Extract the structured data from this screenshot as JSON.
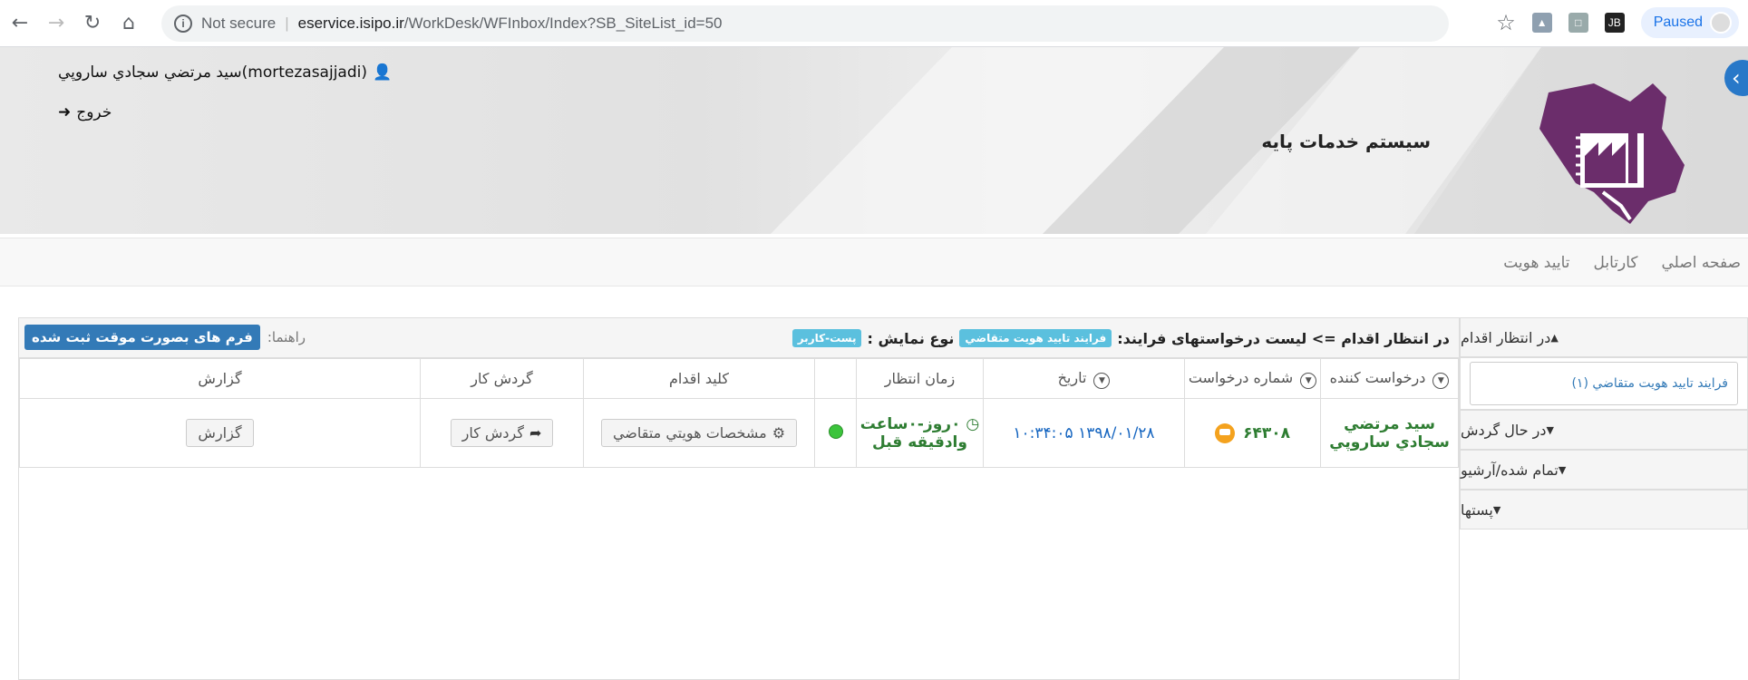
{
  "browser": {
    "secure_label": "Not secure",
    "url_host": "eservice.isipo.ir",
    "url_path": "/WorkDesk/WFInbox/Index?SB_SiteList_id=50",
    "paused_label": "Paused",
    "ext_jb": "JB"
  },
  "header": {
    "user_name": "سيد مرتضي سجادي ساروپي(mortezasajjadi)",
    "logout_label": "خروج",
    "site_title": "سيستم خدمات پايه"
  },
  "nav": {
    "items": [
      "صفحه اصلي",
      "کارتابل",
      "تایید هویت"
    ]
  },
  "sidebar": {
    "pending": "در انتظار اقدام",
    "pending_sub": "فرايند تاييد هويت متقاضي (۱)",
    "in_progress": "در حال گردش",
    "archive": "تمام شده/آرشيو",
    "posts": "پستها"
  },
  "panel": {
    "title_prefix": "در انتظار اقدام => لیست درخواستهای فرایند:",
    "process_label": "فرايند تاييد هويت متقاضي",
    "view_type_text": "نوع نمایش :",
    "view_type_label": "پست-کاربر",
    "guide_label": "راهنما:",
    "guide_button": "فرم های بصورت موقت ثبت شده"
  },
  "table": {
    "headers": [
      "درخواست کننده",
      "شماره درخواست",
      "تاریخ",
      "زمان انتظار",
      "",
      "کلید اقدام",
      "گردش کار",
      "گزارش"
    ],
    "row": {
      "requester": "سيد مرتضي سجادي ساروپي",
      "request_no": "۶۴۳۰۸",
      "date": "۱۳۹۸/۰۱/۲۸ ۱۰:۳۴:۰۵",
      "wait_time_line1": "۰روز-۰ساعت",
      "wait_time_line2": "وادقيقه قبل",
      "action_button": "مشخصات هويتي متقاضي",
      "workflow_button": "گردش کار",
      "report_button": "گزارش"
    }
  },
  "colors": {
    "primary_blue": "#337ab7",
    "label_cyan": "#5bc0de",
    "logo_purple": "#6b2d6b",
    "status_green": "#3cc43c"
  }
}
